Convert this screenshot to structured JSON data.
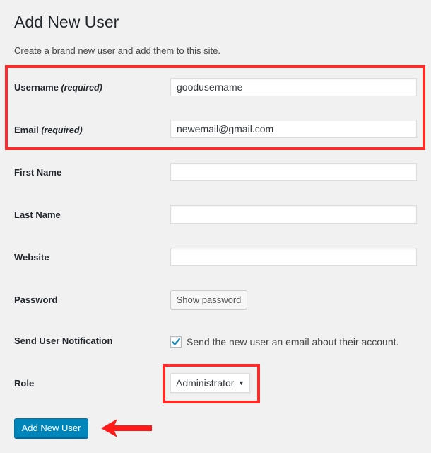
{
  "page": {
    "title": "Add New User",
    "intro": "Create a brand new user and add them to this site."
  },
  "form": {
    "username": {
      "label": "Username",
      "required_note": "(required)",
      "value": "goodusername",
      "placeholder": ""
    },
    "email": {
      "label": "Email",
      "required_note": "(required)",
      "value": "newemail@gmail.com",
      "placeholder": ""
    },
    "first_name": {
      "label": "First Name",
      "value": "",
      "placeholder": ""
    },
    "last_name": {
      "label": "Last Name",
      "value": "",
      "placeholder": ""
    },
    "website": {
      "label": "Website",
      "value": "",
      "placeholder": ""
    },
    "password": {
      "label": "Password",
      "button_label": "Show password"
    },
    "notification": {
      "label": "Send User Notification",
      "checked": true,
      "checkbox_label": "Send the new user an email about their account."
    },
    "role": {
      "label": "Role",
      "selected": "Administrator",
      "caret": "▼"
    },
    "submit_label": "Add New User"
  },
  "annotations": {
    "highlight_color": "#ff2a2a",
    "highlighted": [
      "username",
      "email",
      "role"
    ],
    "arrow_target": "submit",
    "arrow_icon": "left-arrow"
  },
  "colors": {
    "background": "#f1f1f1",
    "text": "#23282d",
    "primary": "#0085ba",
    "checkmark": "#1e8cbe"
  }
}
